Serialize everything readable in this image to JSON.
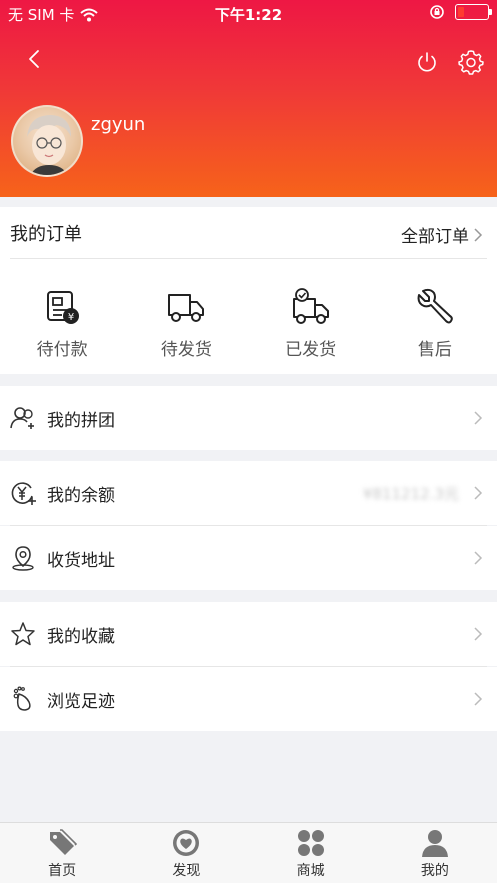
{
  "status_bar": {
    "carrier": "无 SIM 卡",
    "time": "下午1:22",
    "battery_level": 0.18
  },
  "profile": {
    "username": "zgyun"
  },
  "orders": {
    "title": "我的订单",
    "all_label": "全部订单",
    "items": [
      {
        "label": "待付款",
        "icon": "pending-payment-icon"
      },
      {
        "label": "待发货",
        "icon": "truck-icon"
      },
      {
        "label": "已发货",
        "icon": "truck-check-icon"
      },
      {
        "label": "售后",
        "icon": "wrench-icon"
      }
    ]
  },
  "menu": {
    "group_buy": "我的拼团",
    "balance": "我的余额",
    "balance_value": "¥811212.3元",
    "address": "收货地址",
    "favorites": "我的收藏",
    "history": "浏览足迹"
  },
  "tabbar": {
    "items": [
      {
        "label": "首页",
        "icon": "tag-icon"
      },
      {
        "label": "发现",
        "icon": "discover-icon"
      },
      {
        "label": "商城",
        "icon": "grid-icon"
      },
      {
        "label": "我的",
        "icon": "person-icon"
      }
    ]
  },
  "colors": {
    "header_top": "#ee1744",
    "header_bottom": "#f6631a",
    "tab_icon": "#777777"
  }
}
